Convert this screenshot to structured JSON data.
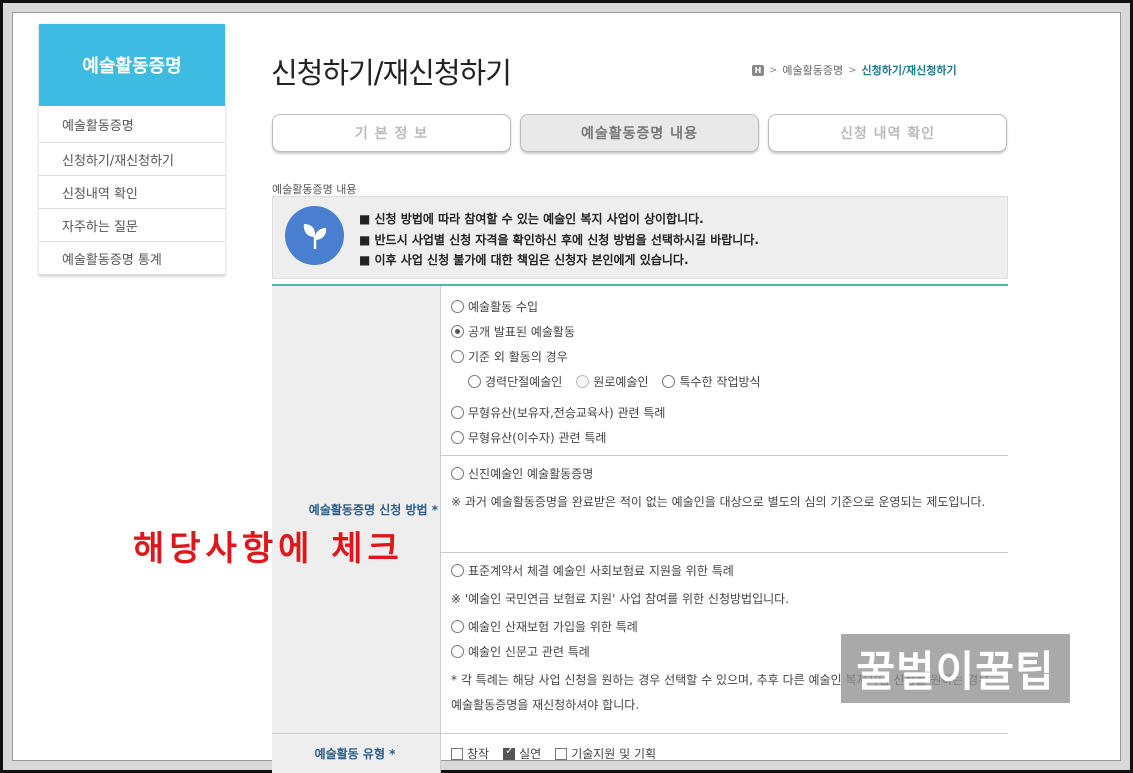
{
  "sidebar": {
    "title": "예술활동증명",
    "items": [
      {
        "label": "예술활동증명"
      },
      {
        "label": "신청하기/재신청하기"
      },
      {
        "label": "신청내역 확인"
      },
      {
        "label": "자주하는 질문"
      },
      {
        "label": "예술활동증명 통계"
      }
    ]
  },
  "header": {
    "title": "신청하기/재신청하기",
    "breadcrumb": {
      "home_icon": "home-icon",
      "level1": "예술활동증명",
      "current": "신청하기/재신청하기"
    }
  },
  "tabs": [
    {
      "label": "기 본 정 보",
      "active": false
    },
    {
      "label": "예술활동증명 내용",
      "active": true
    },
    {
      "label": "신청 내역 확인",
      "active": false
    }
  ],
  "section_label": "예술활동증명 내용",
  "notice": {
    "icon": "leaf-icon",
    "lines": [
      "■ 신청 방법에 따라 참여할 수 있는 예술인 복지 사업이 상이합니다.",
      "■ 반드시 사업별 신청 자격을 확인하신 후에 신청 방법을 선택하시길 바랍니다.",
      "■ 이후 사업 신청 불가에 대한 책임은 신청자 본인에게 있습니다."
    ]
  },
  "form": {
    "method_label": "예술활동증명 신청 방법 *",
    "group1": {
      "opt1": "예술활동 수입",
      "opt2": "공개 발표된 예술활동",
      "opt3": "기준 외 활동의 경우",
      "sub1": "경력단절예술인",
      "sub2": "원로예술인",
      "sub3": "특수한 작업방식",
      "opt4": "무형유산(보유자,전승교육사) 관련 특례",
      "opt5": "무형유산(이수자) 관련 특례"
    },
    "group2": {
      "opt1": "신진예술인 예술활동증명",
      "note": "※ 과거 예술활동증명을 완료받은 적이 없는 예술인을 대상으로 별도의 심의 기준으로 운영되는 제도입니다."
    },
    "group3": {
      "opt1": "표준계약서 체결 예술인 사회보험료 지원을 위한 특례",
      "note1": "※ '예술인 국민연금 보험료 지원' 사업 참여를 위한 신청방법입니다.",
      "opt2": "예술인 산재보험 가입을 위한 특례",
      "opt3": "예술인 신문고 관련 특례",
      "note2": "* 각 특례는 해당 사업 신청을 원하는 경우 선택할 수 있으며, 추후 다른 예술인 복지사업 신청을 원하는 경우 예술활동증명을 재신청하셔야 합니다."
    },
    "type_label": "예술활동 유형 *",
    "types": [
      {
        "label": "창작",
        "checked": false
      },
      {
        "label": "실연",
        "checked": true
      },
      {
        "label": "기술지원 및 기획",
        "checked": false
      }
    ]
  },
  "annotation": "해당사항에 체크",
  "watermark": "꿀벌이꿀팁",
  "colors": {
    "accent": "#3dbbe0",
    "table_top": "#4bb8ad",
    "annotation": "#e0161b",
    "label": "#2a5d8c"
  }
}
